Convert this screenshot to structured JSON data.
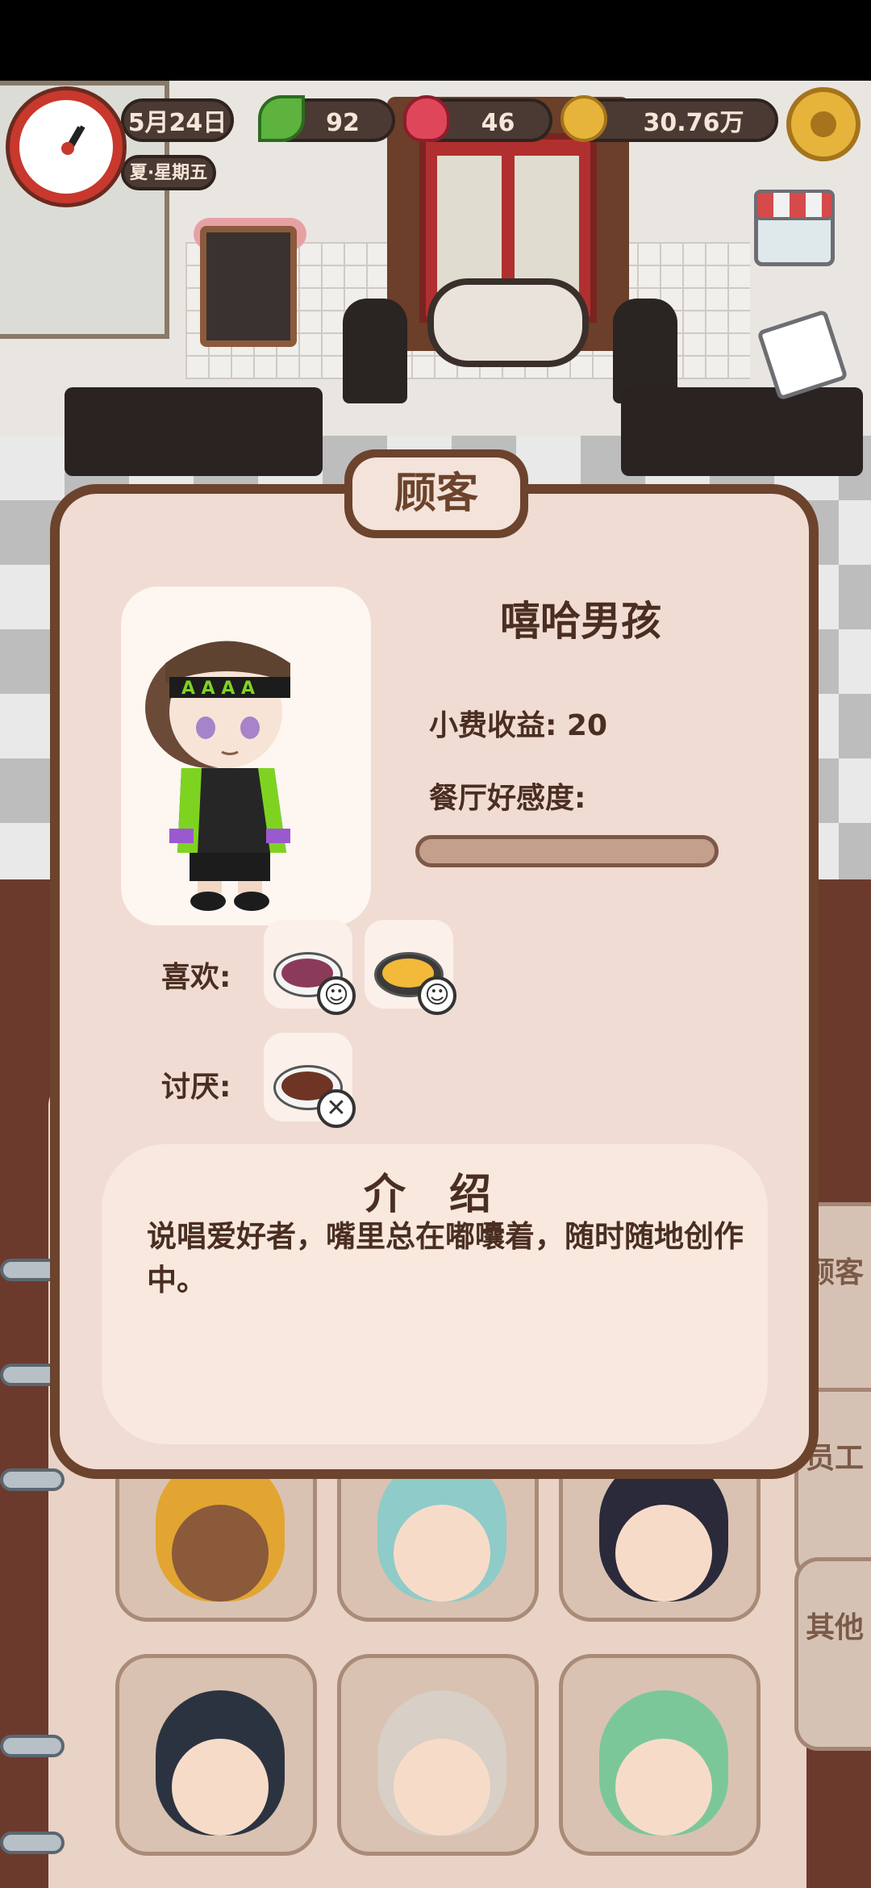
{
  "hud": {
    "date": "5月24日",
    "weekday": "夏·星期五",
    "leaves": "92",
    "hearts": "46",
    "coins": "30.76万"
  },
  "background": {
    "side_tabs": [
      "顾客",
      "员工",
      "其他"
    ]
  },
  "modal": {
    "title": "顾客",
    "customer_name": "嘻哈男孩",
    "tip_income_label": "小费收益: 20",
    "affinity_label": "餐厅好感度:",
    "affinity_level": 0,
    "likes_label": "喜欢:",
    "dislikes_label": "讨厌:",
    "likes": [
      {
        "dish": "purple-sauce-dish",
        "emote": "happy-emote"
      },
      {
        "dish": "omelette-dish",
        "emote": "happy-emote"
      }
    ],
    "dislikes": [
      {
        "dish": "grilled-eggplant-dish",
        "emote": "annoyed-emote"
      }
    ],
    "intro_title": "介 绍",
    "intro_text": "说唱爱好者，嘴里总在嘟囔着，随时随地创作中。"
  },
  "colors": {
    "frame": "#6c432c",
    "panel": "#f0dcd3",
    "text": "#4a2e22",
    "accent_green": "#7ed321",
    "clock_red": "#c8382d",
    "coin_gold": "#e6b43a"
  }
}
